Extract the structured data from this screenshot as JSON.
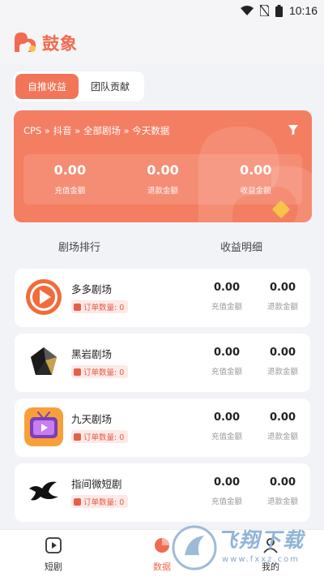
{
  "status_bar": {
    "time": "10:16"
  },
  "header": {
    "app_name": "鼓象"
  },
  "tabs": [
    {
      "label": "自推收益",
      "active": true
    },
    {
      "label": "团队贡献",
      "active": false
    }
  ],
  "summary": {
    "breadcrumb": "CPS » 抖音 » 全部剧场 » 今天数据",
    "stats": [
      {
        "value": "0.00",
        "label": "充值金额"
      },
      {
        "value": "0.00",
        "label": "退款金额"
      },
      {
        "value": "0.00",
        "label": "收益金额"
      }
    ]
  },
  "section_tabs": [
    "剧场排行",
    "收益明细"
  ],
  "theaters": [
    {
      "name": "多多剧场",
      "order_label": "订单数量: 0",
      "recharge": "0.00",
      "recharge_label": "充值金额",
      "refund": "0.00",
      "refund_label": "退款金额"
    },
    {
      "name": "黑岩剧场",
      "order_label": "订单数量: 0",
      "recharge": "0.00",
      "recharge_label": "充值金额",
      "refund": "0.00",
      "refund_label": "退款金额"
    },
    {
      "name": "九天剧场",
      "order_label": "订单数量: 0",
      "recharge": "0.00",
      "recharge_label": "充值金额",
      "refund": "0.00",
      "refund_label": "退款金额"
    },
    {
      "name": "指间微短剧",
      "order_label": "订单数量: 0",
      "recharge": "0.00",
      "recharge_label": "充值金额",
      "refund": "0.00",
      "refund_label": "退款金额"
    }
  ],
  "bottom_nav": [
    {
      "label": "短剧",
      "icon": "play-icon",
      "active": false
    },
    {
      "label": "数据",
      "icon": "pie-chart-icon",
      "active": true
    },
    {
      "label": "我的",
      "icon": "user-icon",
      "active": false
    }
  ],
  "watermark": {
    "text": "飞翔下载",
    "url": "www.fxxz.com"
  },
  "colors": {
    "accent": "#f26b4f",
    "card_bg": "#f47e62"
  }
}
